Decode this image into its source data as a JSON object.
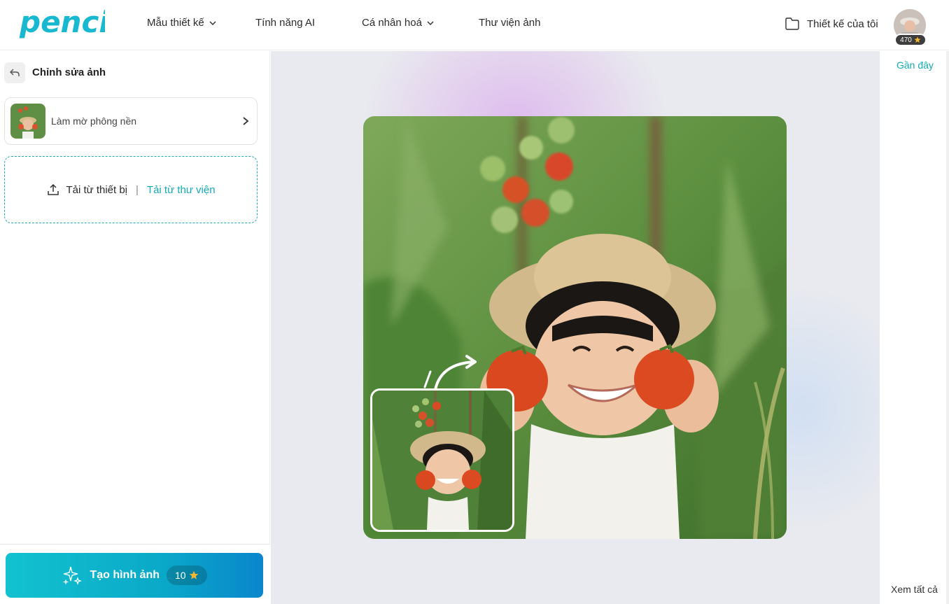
{
  "brand": {
    "logo_text": "penci",
    "accent": "#14aab7"
  },
  "header": {
    "nav": [
      {
        "label": "Mẫu thiết kế",
        "dropdown": true
      },
      {
        "label": "Tính năng AI",
        "dropdown": false
      },
      {
        "label": "Cá nhân hoá",
        "dropdown": true
      },
      {
        "label": "Thư viện ảnh",
        "dropdown": false
      }
    ],
    "my_designs_label": "Thiết kế của tôi",
    "credits": "470"
  },
  "left_panel": {
    "title": "Chỉnh sửa ảnh",
    "tool_label": "Làm mờ phông nền",
    "upload_device": "Tải từ thiết bị",
    "upload_separator": "|",
    "upload_library": "Tải từ thư viện",
    "create_label": "Tạo hình ảnh",
    "create_cost": "10"
  },
  "right_panel": {
    "recent_label": "Gần đây",
    "see_all_label": "Xem tất cả"
  },
  "icons": {
    "back": "undo-arrow-icon",
    "upload": "upload-icon",
    "folder": "folder-icon",
    "sparkle": "sparkle-icon",
    "star": "star-icon"
  }
}
